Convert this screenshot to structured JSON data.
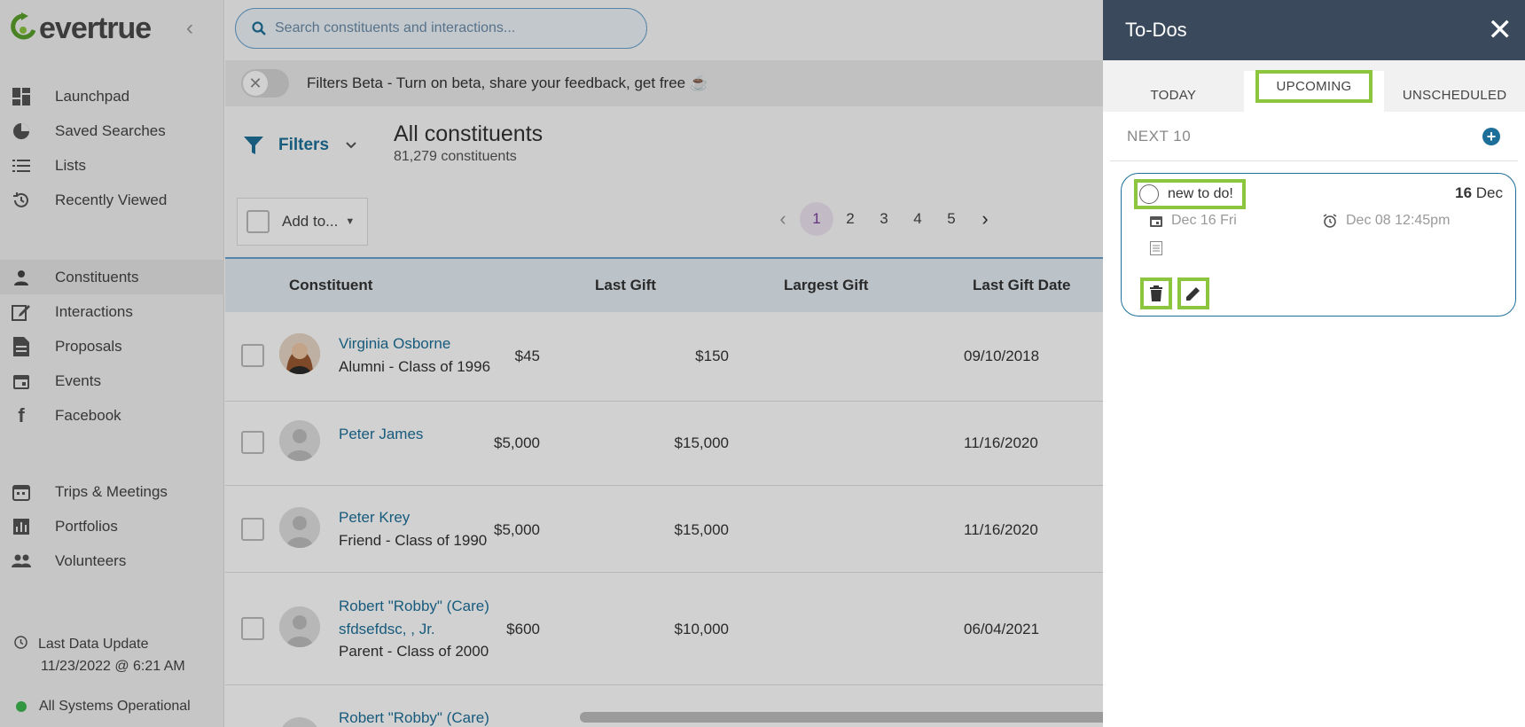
{
  "app": {
    "logo_text": "evertrue",
    "brand_color": "#4a4a4a",
    "accent_color": "#1d6f99",
    "highlight_color": "#8cc63f"
  },
  "sidebar": {
    "collapse_icon": "chevron-left-icon",
    "items": [
      {
        "label": "Launchpad",
        "icon": "dashboard-icon"
      },
      {
        "label": "Saved Searches",
        "icon": "pie-chart-icon"
      },
      {
        "label": "Lists",
        "icon": "list-icon"
      },
      {
        "label": "Recently Viewed",
        "icon": "history-icon"
      },
      {
        "label": "Constituents",
        "icon": "person-icon",
        "active": true
      },
      {
        "label": "Interactions",
        "icon": "edit-icon"
      },
      {
        "label": "Proposals",
        "icon": "document-icon"
      },
      {
        "label": "Events",
        "icon": "calendar-icon"
      },
      {
        "label": "Facebook",
        "icon": "facebook-icon"
      },
      {
        "label": "Trips & Meetings",
        "icon": "calendar-grid-icon"
      },
      {
        "label": "Portfolios",
        "icon": "bar-chart-icon"
      },
      {
        "label": "Volunteers",
        "icon": "people-icon"
      }
    ],
    "last_update_label": "Last Data Update",
    "last_update_value": "11/23/2022 @ 6:21 AM",
    "system_status": "All Systems Operational"
  },
  "search": {
    "placeholder": "Search constituents and interactions..."
  },
  "beta": {
    "text": "Filters Beta - Turn on beta, share your feedback, get free ☕"
  },
  "filters": {
    "label": "Filters"
  },
  "page": {
    "title": "All constituents",
    "count": "81,279 constituents"
  },
  "toolbar": {
    "add_to_label": "Add to..."
  },
  "pager": {
    "pages": [
      "1",
      "2",
      "3",
      "4",
      "5"
    ],
    "current": "1"
  },
  "table": {
    "columns": [
      "Constituent",
      "Last Gift",
      "Largest Gift",
      "Last Gift Date"
    ],
    "rows": [
      {
        "name": "Virginia Osborne",
        "sub": "Alumni - Class of 1996",
        "last_gift": "$45",
        "largest_gift": "$150",
        "last_date": "09/10/2018",
        "photo": true
      },
      {
        "name": "Peter James",
        "sub": "",
        "last_gift": "$5,000",
        "largest_gift": "$15,000",
        "last_date": "11/16/2020",
        "photo": false
      },
      {
        "name": "Peter Krey",
        "sub": "Friend - Class of 1990",
        "last_gift": "$5,000",
        "largest_gift": "$15,000",
        "last_date": "11/16/2020",
        "photo": false
      },
      {
        "name": "Robert \"Robby\" (Care)",
        "name2": "sfdsefdsc, , Jr.",
        "sub": "Parent - Class of 2000",
        "last_gift": "$600",
        "largest_gift": "$10,000",
        "last_date": "06/04/2021",
        "photo": false
      },
      {
        "name": "Robert \"Robby\" (Care)",
        "sub": "",
        "last_gift": "",
        "largest_gift": "",
        "last_date": "",
        "photo": false
      }
    ]
  },
  "todos": {
    "title": "To-Dos",
    "tabs": [
      "TODAY",
      "UPCOMING",
      "UNSCHEDULED"
    ],
    "active_tab": "UPCOMING",
    "section_label": "NEXT 10",
    "item": {
      "name": "new to do!",
      "day": "16",
      "month": "Dec",
      "due": "Dec 16 Fri",
      "reminder": "Dec 08 12:45pm"
    }
  }
}
